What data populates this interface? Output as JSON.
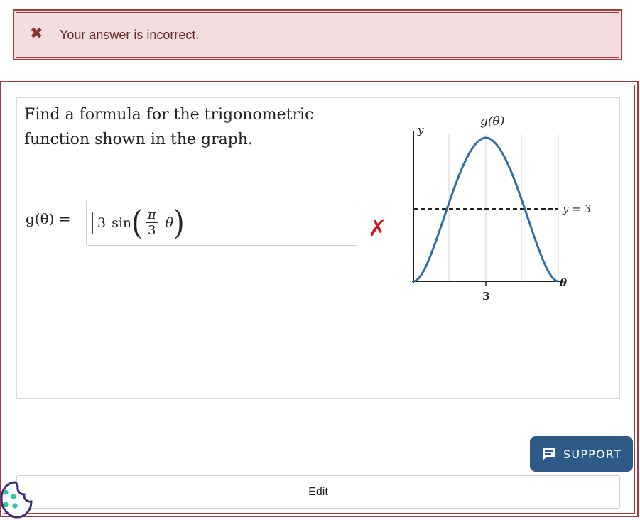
{
  "feedback": {
    "icon": "x-icon",
    "message": "Your answer is incorrect.",
    "color": "#a23b3b"
  },
  "question": {
    "prompt": "Find a formula for the trigonometric function shown in the graph.",
    "function_label": "g(θ) =",
    "answer": {
      "coefficient": "3",
      "function": "sin",
      "fraction_numerator": "π",
      "fraction_denominator": "3",
      "variable": "θ"
    },
    "result_icon": "incorrect-x-icon",
    "result_mark": "✗"
  },
  "graph": {
    "title": "g(θ)",
    "y_axis_label": "y",
    "x_axis_label": "θ",
    "x_tick_label": "3",
    "reference_line_label": "y = 3",
    "curve_color": "#2f6ea8"
  },
  "buttons": {
    "support_label": "SUPPORT",
    "support_icon": "chat-icon",
    "edit_label": "Edit"
  },
  "widgets": {
    "cookie_icon": "cookie-icon"
  }
}
